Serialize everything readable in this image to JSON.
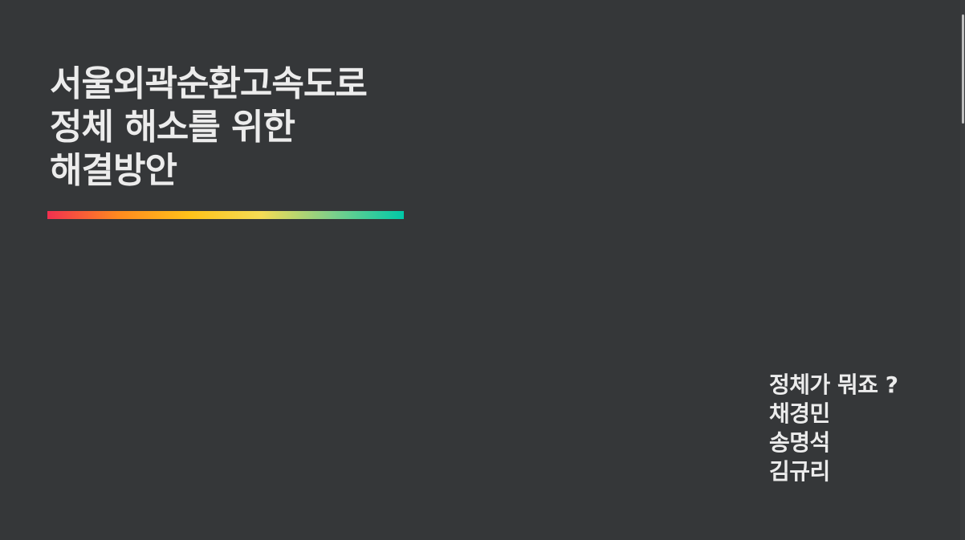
{
  "slide": {
    "title_lines": [
      "서울외곽순환고속도로",
      "정체 해소를 위한",
      "해결방안"
    ],
    "team_name": "정체가 뭐죠 ?",
    "members": [
      "채경민",
      "송명석",
      "김규리"
    ]
  },
  "colors": {
    "background": "#353739",
    "text": "#ececec",
    "accent_gradient": [
      "#f2304f",
      "#ff8a1f",
      "#ffc21a",
      "#f5dc55",
      "#7dcf8a",
      "#00c8a8"
    ]
  }
}
